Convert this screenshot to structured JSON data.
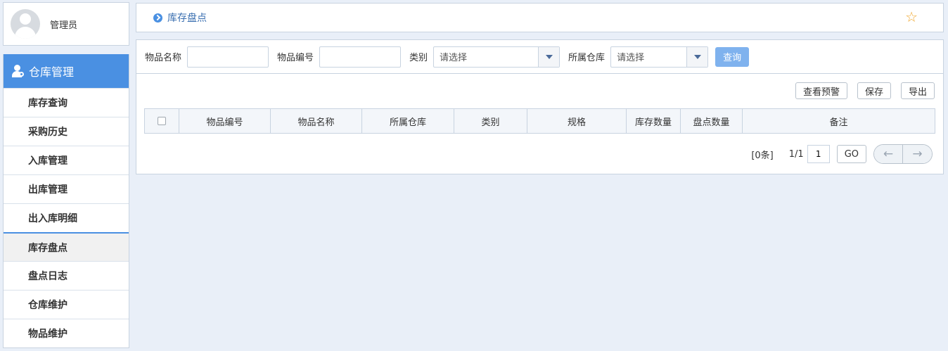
{
  "user": {
    "name": "管理员",
    "avatar_icon": "user-avatar-icon"
  },
  "nav": {
    "header": "仓库管理",
    "header_icon": "user-group-icon",
    "items": [
      {
        "label": "库存查询",
        "active": false
      },
      {
        "label": "采购历史",
        "active": false
      },
      {
        "label": "入库管理",
        "active": false
      },
      {
        "label": "出库管理",
        "active": false
      },
      {
        "label": "出入库明细",
        "active": false
      },
      {
        "label": "库存盘点",
        "active": true
      },
      {
        "label": "盘点日志",
        "active": false
      },
      {
        "label": "仓库维护",
        "active": false
      },
      {
        "label": "物品维护",
        "active": false
      }
    ]
  },
  "breadcrumb": {
    "current": "库存盘点",
    "favorite_icon": "star-outline-icon"
  },
  "search": {
    "item_name_label": "物品名称",
    "item_name_value": "",
    "item_code_label": "物品编号",
    "item_code_value": "",
    "category_label": "类别",
    "category_value": "请选择",
    "warehouse_label": "所属仓库",
    "warehouse_value": "请选择",
    "query_button": "查询"
  },
  "actions": {
    "warning": "查看预警",
    "save": "保存",
    "export": "导出"
  },
  "table": {
    "columns": [
      "物品编号",
      "物品名称",
      "所属仓库",
      "类别",
      "规格",
      "库存数量",
      "盘点数量",
      "备注"
    ],
    "rows": []
  },
  "pager": {
    "total": "[0条]",
    "pages": "1/1",
    "page_input": "1",
    "go": "GO",
    "prev_icon": "←",
    "next_icon": "→"
  },
  "colors": {
    "accent": "#4a90e2",
    "background": "#e9eff8",
    "star": "#f0a830"
  }
}
